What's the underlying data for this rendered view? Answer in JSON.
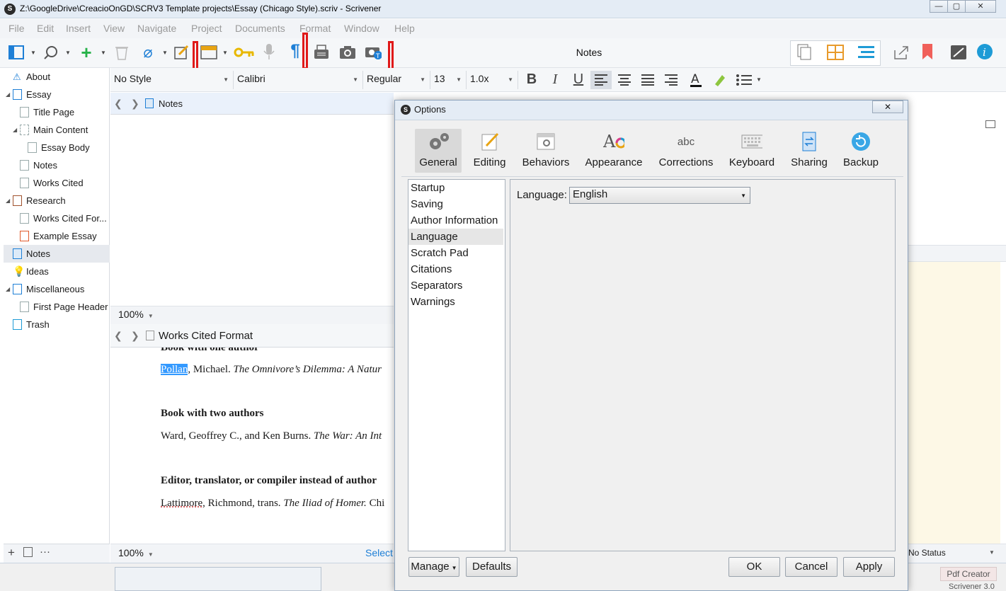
{
  "window": {
    "title": "Z:\\GoogleDrive\\CreacioOnGD\\SCRV3 Template projects\\Essay (Chicago Style).scriv - Scrivener"
  },
  "menu": [
    "File",
    "Edit",
    "Insert",
    "View",
    "Navigate",
    "Project",
    "Documents",
    "Format",
    "Window",
    "Help"
  ],
  "toolbar": {
    "title": "Notes"
  },
  "binder": {
    "items": [
      {
        "label": "About"
      },
      {
        "label": "Essay"
      },
      {
        "label": "Title Page"
      },
      {
        "label": "Main Content"
      },
      {
        "label": "Essay Body"
      },
      {
        "label": "Notes"
      },
      {
        "label": "Works Cited"
      },
      {
        "label": "Research"
      },
      {
        "label": "Works Cited For..."
      },
      {
        "label": "Example Essay"
      },
      {
        "label": "Notes"
      },
      {
        "label": "Ideas"
      },
      {
        "label": "Miscellaneous"
      },
      {
        "label": "First Page Header"
      },
      {
        "label": "Trash"
      }
    ],
    "footer": {
      "add": "+",
      "more": "···"
    }
  },
  "format_bar": {
    "style": "No Style",
    "font": "Calibri",
    "weight": "Regular",
    "size": "13",
    "spacing": "1.0x",
    "bold": "B",
    "italic": "I",
    "underline": "U"
  },
  "editor_top": {
    "title": "Notes",
    "zoom": "100%"
  },
  "editor_bottom": {
    "title": "Works Cited Format",
    "zoom": "100%",
    "footer_text": "Select",
    "lines": {
      "h0": "Book with one author",
      "p1_selected": "Pollan",
      "p1_rest": ", Michael. ",
      "p1_italic": "The Omnivore’s Dilemma: A Natur",
      "h1": "Book with two authors",
      "p2": "Ward, Geoffrey C., and Ken Burns. ",
      "p2_italic": "The War: An Int",
      "h2": "Editor, translator, or compiler instead of author",
      "p3_underlined": "Lattimore,",
      "p3_rest": " Richmond, trans. ",
      "p3_italic": "The Iliad of Homer.",
      "p3_end": " Chi"
    }
  },
  "inspector": {
    "status": "No Status"
  },
  "taskbar": {
    "pdf": "Pdf Creator",
    "scrivener": "Scrivener 3.0"
  },
  "dialog": {
    "title": "Options",
    "close": "✕",
    "categories": [
      {
        "label": "General"
      },
      {
        "label": "Editing"
      },
      {
        "label": "Behaviors"
      },
      {
        "label": "Appearance"
      },
      {
        "label": "Corrections"
      },
      {
        "label": "Keyboard"
      },
      {
        "label": "Sharing"
      },
      {
        "label": "Backup"
      }
    ],
    "corrections_icon_text": "abc",
    "sections": [
      "Startup",
      "Saving",
      "Author Information",
      "Language",
      "Scratch Pad",
      "Citations",
      "Separators",
      "Warnings"
    ],
    "language": {
      "label": "Language:",
      "value": "English"
    },
    "buttons": {
      "manage": "Manage",
      "defaults": "Defaults",
      "ok": "OK",
      "cancel": "Cancel",
      "apply": "Apply"
    }
  },
  "colors": {
    "accent": "#1e7fd6",
    "marker": "#e01919",
    "selection": "#3399ff",
    "note": "#fdf8e6"
  }
}
